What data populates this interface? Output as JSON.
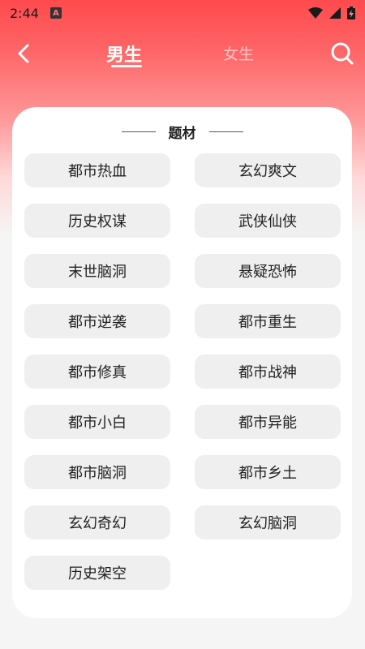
{
  "status_bar": {
    "time": "2:44",
    "notification_icon": "A"
  },
  "header": {
    "tabs": [
      {
        "label": "男生",
        "selected": true
      },
      {
        "label": "女生",
        "selected": false
      }
    ]
  },
  "card": {
    "title": "题材",
    "genres": [
      "都市热血",
      "玄幻爽文",
      "历史权谋",
      "武侠仙侠",
      "末世脑洞",
      "悬疑恐怖",
      "都市逆袭",
      "都市重生",
      "都市修真",
      "都市战神",
      "都市小白",
      "都市异能",
      "都市脑洞",
      "都市乡土",
      "玄幻奇幻",
      "玄幻脑洞",
      "历史架空"
    ]
  },
  "colors": {
    "accent": "#fe4a4d",
    "chip_bg": "#efefef"
  }
}
